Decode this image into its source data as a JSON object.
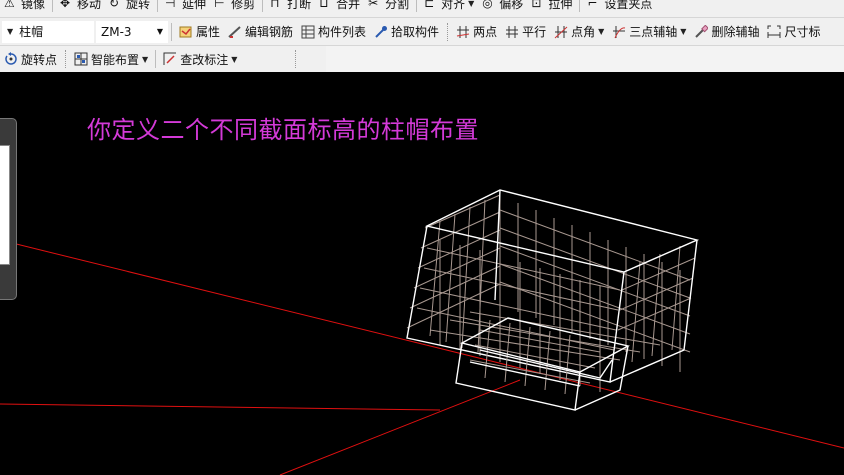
{
  "toolbar1": {
    "items": [
      "镜像",
      "移动",
      "旋转",
      "延伸",
      "修剪",
      "打断",
      "合并",
      "分割",
      "对齐",
      "偏移",
      "拉伸",
      "设置夹点"
    ]
  },
  "toolbar2": {
    "type_combo": "柱帽",
    "name_combo": "ZM-3",
    "properties": "属性",
    "edit_rebar": "编辑钢筋",
    "component_list": "构件列表",
    "pick_component": "拾取构件",
    "two_points": "两点",
    "parallel": "平行",
    "point_angle": "点角",
    "three_point_axis": "三点辅轴",
    "delete_axis": "删除辅轴",
    "dimension": "尺寸标"
  },
  "toolbar3": {
    "rotate_point": "旋转点",
    "smart_layout": "智能布置",
    "modify_annotation": "查改标注"
  },
  "canvas": {
    "annotation_text": "你定义二个不同截面标高的柱帽布置",
    "annotation_color": "#d43ad8",
    "axis_color": "#e01010"
  }
}
